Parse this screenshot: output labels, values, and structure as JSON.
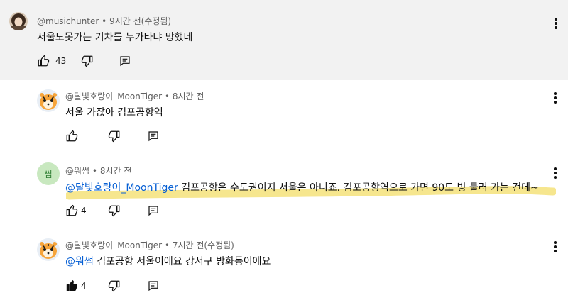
{
  "colors": {
    "band": "#f2f2f2",
    "mention": "#065fd4",
    "meta": "#606060",
    "highlight": "#f5e27a",
    "avatar_green": "#c8e8bf",
    "avatar_green_text": "#2e7d32"
  },
  "comments": [
    {
      "author": "@musichunter",
      "time": "9시간 전(수정됨)",
      "text": "서울도못가는 기차를 누가타냐 망했네",
      "likes": "43",
      "avatar_icon": "person-photo-avatar",
      "liked": false
    },
    {
      "author": "@달빛호랑이_MoonTiger",
      "time": "8시간 전",
      "text": "서울 가잖아 김포공항역",
      "likes": "",
      "avatar_icon": "tiger-avatar",
      "liked": false
    },
    {
      "author": "@워썸",
      "time": "8시간 전",
      "mention": "@달빛호랑이_MoonTiger",
      "text": "김포공항은 수도권이지 서울은 아니죠. 김포공항역으로 가면 90도 빙 둘러 가는 건데~",
      "likes": "4",
      "avatar_letter": "썸",
      "liked": false
    },
    {
      "author": "@달빛호랑이_MoonTiger",
      "time": "7시간 전(수정됨)",
      "mention": "@워썸",
      "text": "김포공항 서울이에요 강서구 방화동이에요",
      "likes": "4",
      "avatar_icon": "tiger-avatar",
      "liked": true
    }
  ],
  "separator": "•"
}
